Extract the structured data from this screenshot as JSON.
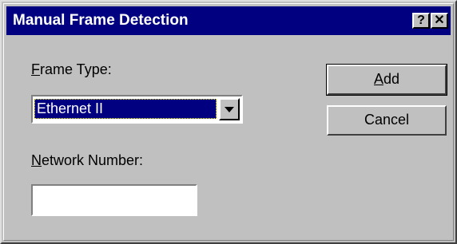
{
  "window": {
    "title": "Manual Frame Detection",
    "help_glyph": "?",
    "close_glyph": "✕"
  },
  "form": {
    "frame_type_label_mnemonic": "F",
    "frame_type_label_rest": "rame Type:",
    "frame_type_selected": "Ethernet II",
    "network_number_label_mnemonic": "N",
    "network_number_label_rest": "etwork Number:",
    "network_number_value": ""
  },
  "buttons": {
    "add_mnemonic": "A",
    "add_rest": "dd",
    "cancel_label": "Cancel"
  },
  "colors": {
    "title_bar": "#000080",
    "face": "#c0c0c0",
    "selection": "#000080"
  }
}
